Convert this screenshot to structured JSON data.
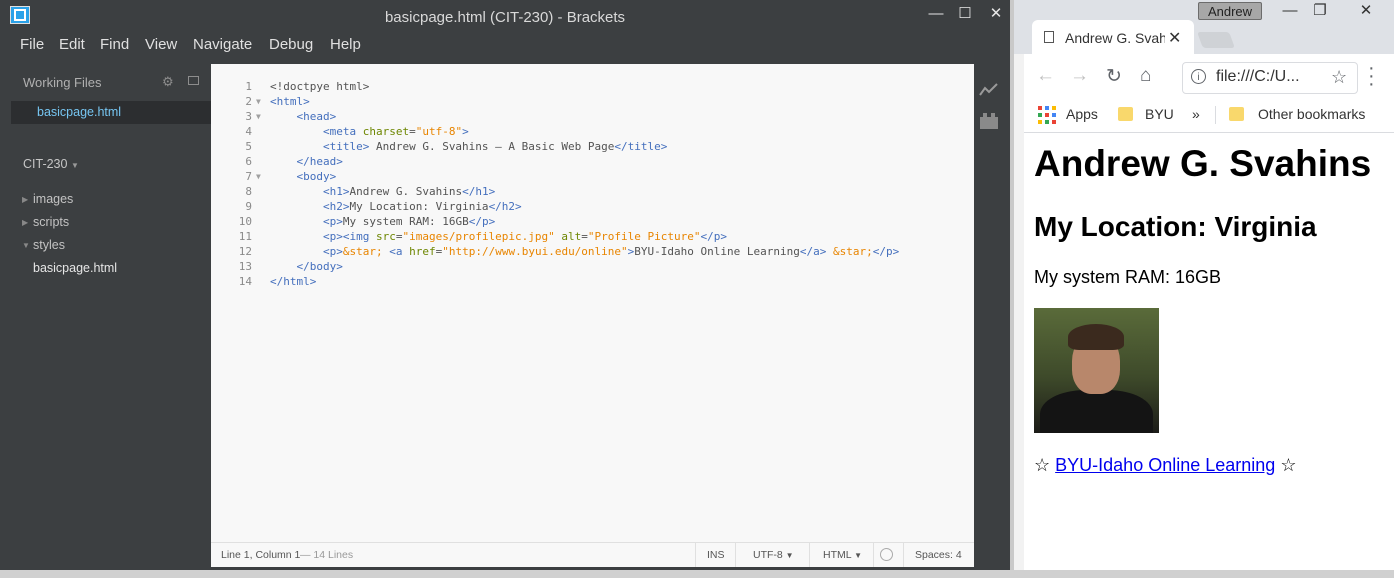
{
  "brackets": {
    "window_title": "basicpage.html (CIT-230) - Brackets",
    "controls": {
      "minimize": "—",
      "maximize": "☐",
      "close": "✕"
    },
    "menu": [
      "File",
      "Edit",
      "Find",
      "View",
      "Navigate",
      "Debug",
      "Help"
    ],
    "sidebar": {
      "working_files_header": "Working Files",
      "working_file": "basicpage.html",
      "project": "CIT-230",
      "tree": [
        {
          "label": "images"
        },
        {
          "label": "scripts"
        },
        {
          "label": "styles"
        },
        {
          "label": "basicpage.html"
        }
      ]
    },
    "editor": {
      "line_numbers": [
        "1",
        "2",
        "3",
        "4",
        "5",
        "6",
        "7",
        "8",
        "9",
        "10",
        "11",
        "12",
        "13",
        "14"
      ]
    },
    "status": {
      "position": "Line 1, Column 1",
      "lines": "— 14 Lines",
      "mode": "INS",
      "encoding": "UTF-8",
      "language": "HTML",
      "spaces": "Spaces: 4"
    }
  },
  "chrome": {
    "profile": "Andrew",
    "tab_title": "Andrew G. Svahins – A Basic Web Page",
    "url": "file:///C:/U...",
    "bookmarks": [
      "Apps",
      "BYU",
      "»",
      "Other bookmarks"
    ],
    "page": {
      "h1": "Andrew G. Svahins",
      "h2": "My Location: Virginia",
      "p_ram": "My system RAM: 16GB",
      "photo_alt": "Profile Picture",
      "star": "☆",
      "link_text": "BYU-Idaho Online Learning"
    }
  },
  "colors": {
    "editor_bg": "#f8f8f8",
    "chrome_bg": "#3c3f41",
    "tag": "#446fbd",
    "attr": "#6d8600",
    "value": "#e88501",
    "active_file": "#76c6f2",
    "link": "#0000ee"
  }
}
